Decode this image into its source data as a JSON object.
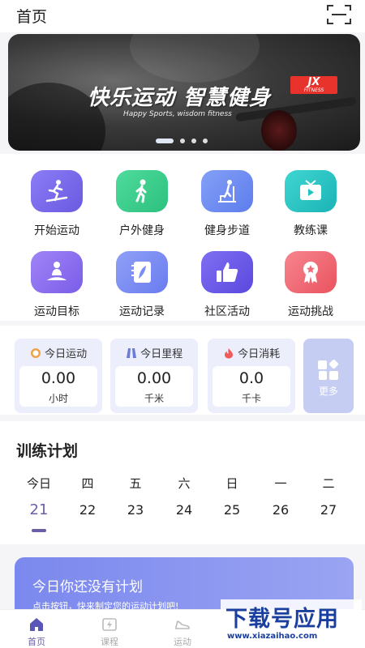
{
  "header": {
    "title": "首页"
  },
  "banner": {
    "slogan": "快乐运动  智慧健身",
    "subtitle": "Happy Sports, wisdom fitness",
    "logo_text": "JX",
    "logo_sub": "FITNESS",
    "slide_count": 4,
    "active_slide": 1
  },
  "features": [
    {
      "label": "开始运动",
      "icon": "treadmill-runner-icon",
      "color": "#7b6cf0"
    },
    {
      "label": "户外健身",
      "icon": "running-person-icon",
      "color": "#35cc8a"
    },
    {
      "label": "健身步道",
      "icon": "stairs-walker-icon",
      "color": "#6b8cf2"
    },
    {
      "label": "教练课",
      "icon": "tv-play-icon",
      "color": "#22c3c3"
    },
    {
      "label": "运动目标",
      "icon": "meditation-icon",
      "color": "#8a6ef2"
    },
    {
      "label": "运动记录",
      "icon": "notebook-feather-icon",
      "color": "#7b8cf4"
    },
    {
      "label": "社区活动",
      "icon": "thumbs-up-icon",
      "color": "#6c5be8"
    },
    {
      "label": "运动挑战",
      "icon": "medal-icon",
      "color": "#f06a78"
    }
  ],
  "stats": [
    {
      "title": "今日运动",
      "value": "0.00",
      "unit": "小时",
      "icon": "timer-icon"
    },
    {
      "title": "今日里程",
      "value": "0.00",
      "unit": "千米",
      "icon": "road-icon"
    },
    {
      "title": "今日消耗",
      "value": "0.0",
      "unit": "千卡",
      "icon": "flame-icon"
    }
  ],
  "more": {
    "label": "更多"
  },
  "plan": {
    "title": "训练计划",
    "days": [
      {
        "weekday": "今日",
        "date": "21",
        "selected": true
      },
      {
        "weekday": "四",
        "date": "22"
      },
      {
        "weekday": "五",
        "date": "23"
      },
      {
        "weekday": "六",
        "date": "24"
      },
      {
        "weekday": "日",
        "date": "25"
      },
      {
        "weekday": "一",
        "date": "26"
      },
      {
        "weekday": "二",
        "date": "27"
      }
    ]
  },
  "empty_plan": {
    "title": "今日你还没有计划",
    "subtitle": "点击按钮，快来制定您的运动计划吧!"
  },
  "tabs": [
    {
      "label": "首页",
      "icon": "home-icon",
      "active": true
    },
    {
      "label": "课程",
      "icon": "course-icon"
    },
    {
      "label": "运动",
      "icon": "sneaker-icon"
    }
  ],
  "watermark": {
    "line1": "下载号应用",
    "line2": "www.xiazaihao.com"
  },
  "colors": {
    "accent": "#6b5ea8",
    "stat_bg": "#eceefb",
    "card_gradient_start": "#7b88ee"
  }
}
